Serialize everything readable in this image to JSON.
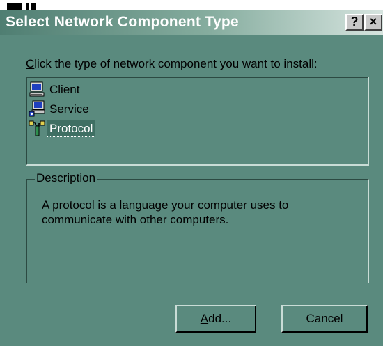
{
  "dialog": {
    "title": "Select Network Component Type",
    "help_button": "?",
    "close_button": "×"
  },
  "prompt": {
    "mnemonic": "C",
    "rest": "lick the type of network component you want to install:"
  },
  "list": {
    "items": [
      {
        "label": "Client",
        "icon": "client-icon",
        "selected": false
      },
      {
        "label": "Service",
        "icon": "service-icon",
        "selected": false
      },
      {
        "label": "Protocol",
        "icon": "protocol-icon",
        "selected": true
      }
    ]
  },
  "description": {
    "legend": "Description",
    "text": "A protocol is a language your computer uses to communicate with other computers."
  },
  "buttons": {
    "add_mnemonic": "A",
    "add_rest": "dd...",
    "cancel": "Cancel"
  },
  "colors": {
    "dialog_background": "#5a8a7e",
    "selection_highlight": "#3f6f63"
  }
}
